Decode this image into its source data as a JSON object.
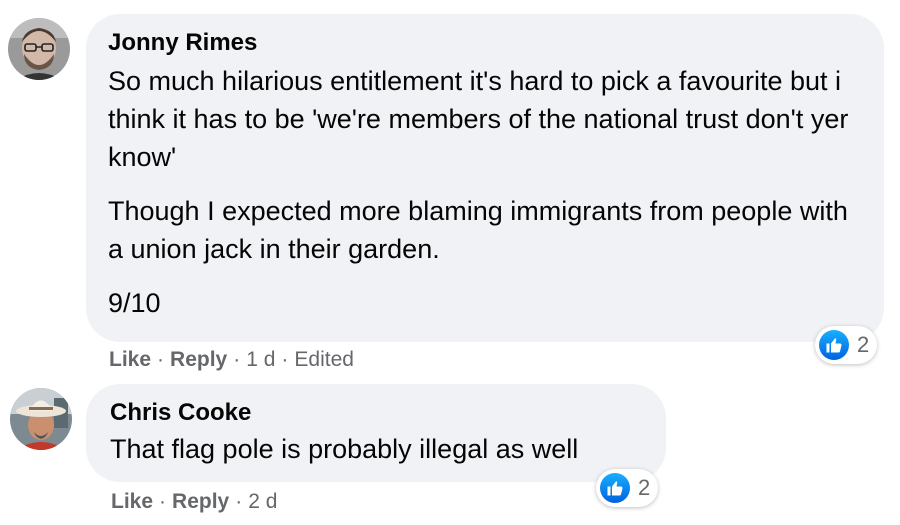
{
  "comments": [
    {
      "author": "Jonny Rimes",
      "paragraphs": [
        "So much hilarious entitlement it's hard to pick a favourite but i think it has to be 'we're members of the national trust don't yer know'",
        "Though I expected more blaming immigrants from people with a union jack in their garden.",
        "9/10"
      ],
      "actions": {
        "like": "Like",
        "reply": "Reply",
        "time": "1 d",
        "edited": "Edited"
      },
      "reaction_count": "2"
    },
    {
      "author": "Chris Cooke",
      "paragraphs": [
        "That flag pole is probably illegal as well"
      ],
      "actions": {
        "like": "Like",
        "reply": "Reply",
        "time": "2 d"
      },
      "reaction_count": "2"
    }
  ],
  "colors": {
    "bubble": "#f0f2f5",
    "meta_text": "#65676b",
    "like_blue": "#0866ff"
  },
  "icons": {
    "reaction": "thumbs-up-icon"
  }
}
